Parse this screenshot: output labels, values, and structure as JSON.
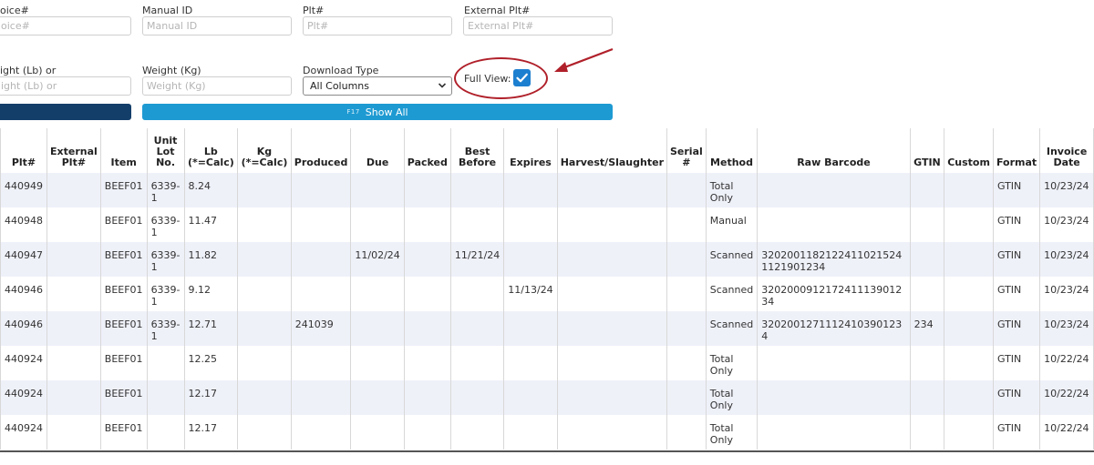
{
  "filters": {
    "row1": [
      {
        "label": "oice#",
        "placeholder": "oice#"
      },
      {
        "label": "Manual ID",
        "placeholder": "Manual ID"
      },
      {
        "label": "Plt#",
        "placeholder": "Plt#"
      },
      {
        "label": "External Plt#",
        "placeholder": "External Plt#"
      }
    ],
    "row2": [
      {
        "label": "ight (Lb) or",
        "placeholder": "ight (Lb) or"
      },
      {
        "label": "Weight (Kg)",
        "placeholder": "Weight (Kg)"
      }
    ],
    "download_type": {
      "label": "Download Type",
      "value": "All Columns"
    },
    "full_view": {
      "label": "Full View:",
      "checked": true
    }
  },
  "buttons": {
    "show_all_key": "F17",
    "show_all_label": "Show All"
  },
  "table": {
    "headers": [
      "Plt#",
      "External Plt#",
      "Item",
      "Unit Lot No.",
      "Lb (*=Calc)",
      "Kg (*=Calc)",
      "Produced",
      "Due",
      "Packed",
      "Best Before",
      "Expires",
      "Harvest/Slaughter",
      "Serial #",
      "Method",
      "Raw Barcode",
      "GTIN",
      "Custom",
      "Format",
      "Invoice Date"
    ],
    "rows": [
      [
        "440949",
        "",
        "BEEF01",
        "6339-1",
        "8.24",
        "",
        "",
        "",
        "",
        "",
        "",
        "",
        "",
        "Total Only",
        "",
        "",
        "",
        "GTIN",
        "10/23/24"
      ],
      [
        "440948",
        "",
        "BEEF01",
        "6339-1",
        "11.47",
        "",
        "",
        "",
        "",
        "",
        "",
        "",
        "",
        "Manual",
        "",
        "",
        "",
        "GTIN",
        "10/23/24"
      ],
      [
        "440947",
        "",
        "BEEF01",
        "6339-1",
        "11.82",
        "",
        "",
        "11/02/24",
        "",
        "11/21/24",
        "",
        "",
        "",
        "Scanned",
        "320200118212241102152411219012​34",
        "",
        "",
        "GTIN",
        "10/23/24"
      ],
      [
        "440946",
        "",
        "BEEF01",
        "6339-1",
        "9.12",
        "",
        "",
        "",
        "",
        "",
        "11/13/24",
        "",
        "",
        "Scanned",
        "3202000912172411139012​34",
        "",
        "",
        "GTIN",
        "10/23/24"
      ],
      [
        "440946",
        "",
        "BEEF01",
        "6339-1",
        "12.71",
        "",
        "241039",
        "",
        "",
        "",
        "",
        "",
        "",
        "Scanned",
        "3202001271112410390123​4",
        "234",
        "",
        "GTIN",
        "10/23/24"
      ],
      [
        "440924",
        "",
        "BEEF01",
        "",
        "12.25",
        "",
        "",
        "",
        "",
        "",
        "",
        "",
        "",
        "Total Only",
        "",
        "",
        "",
        "GTIN",
        "10/22/24"
      ],
      [
        "440924",
        "",
        "BEEF01",
        "",
        "12.17",
        "",
        "",
        "",
        "",
        "",
        "",
        "",
        "",
        "Total Only",
        "",
        "",
        "",
        "GTIN",
        "10/22/24"
      ],
      [
        "440924",
        "",
        "BEEF01",
        "",
        "12.17",
        "",
        "",
        "",
        "",
        "",
        "",
        "",
        "",
        "Total Only",
        "",
        "",
        "",
        "GTIN",
        "10/22/24"
      ]
    ]
  },
  "colors": {
    "primary_blue": "#1e9ad2",
    "dark_blue": "#143e6a",
    "annotation_red": "#b0202a",
    "checkbox_blue": "#1d7fd0"
  },
  "icons": {
    "checkbox": "check-icon",
    "chevron": "chevron-down-icon",
    "annotation": "arrow-icon"
  }
}
